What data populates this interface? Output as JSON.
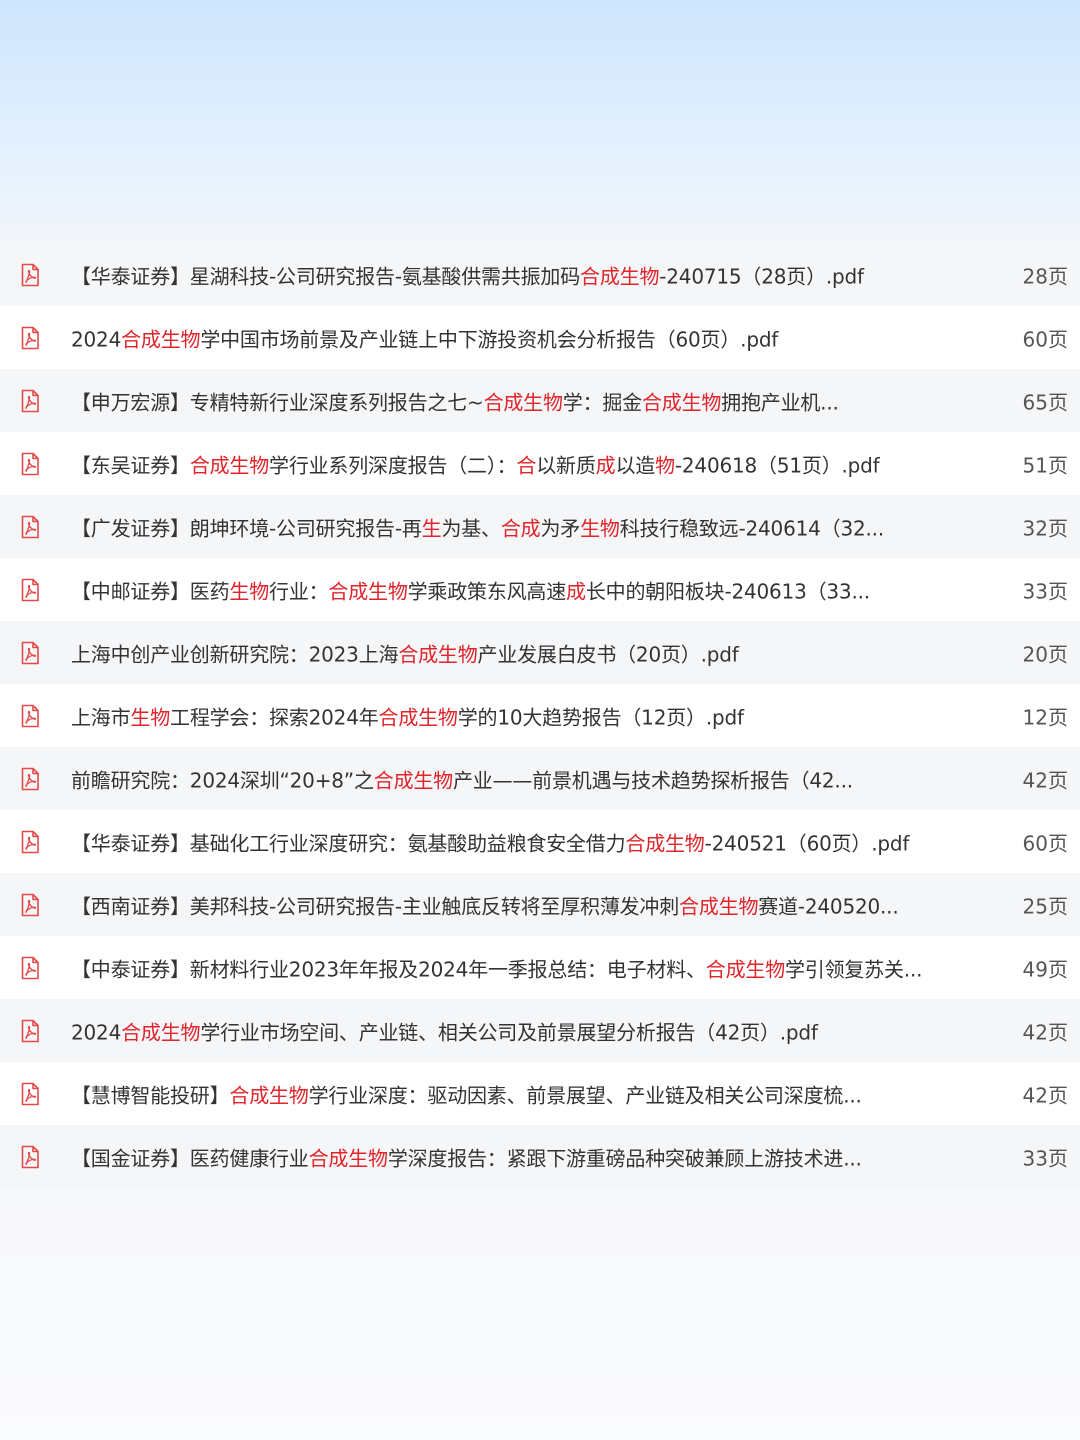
{
  "colors": {
    "highlight": "#e0242a",
    "text": "#333333",
    "icon": "#e44a4a"
  },
  "icon_name": "pdf-file-icon",
  "files": [
    {
      "segments": [
        {
          "t": "【华泰证券】星湖科技-公司研究报告-氨基酸供需共振加码"
        },
        {
          "t": "合成生物",
          "hl": true
        },
        {
          "t": "-240715（28页）.pdf"
        }
      ],
      "pages": "28页"
    },
    {
      "segments": [
        {
          "t": "2024"
        },
        {
          "t": "合成生物",
          "hl": true
        },
        {
          "t": "学中国市场前景及产业链上中下游投资机会分析报告（60页）.pdf"
        }
      ],
      "pages": "60页"
    },
    {
      "segments": [
        {
          "t": "【申万宏源】专精特新行业深度系列报告之七~"
        },
        {
          "t": "合成生物",
          "hl": true
        },
        {
          "t": "学：掘金"
        },
        {
          "t": "合成生物",
          "hl": true
        },
        {
          "t": "拥抱产业机..."
        }
      ],
      "pages": "65页"
    },
    {
      "segments": [
        {
          "t": "【东吴证券】"
        },
        {
          "t": "合成生物",
          "hl": true
        },
        {
          "t": "学行业系列深度报告（二）："
        },
        {
          "t": "合",
          "hl": true
        },
        {
          "t": "以新质"
        },
        {
          "t": "成",
          "hl": true
        },
        {
          "t": "以造"
        },
        {
          "t": "物",
          "hl": true
        },
        {
          "t": "-240618（51页）.pdf"
        }
      ],
      "pages": "51页"
    },
    {
      "segments": [
        {
          "t": "【广发证券】朗坤环境-公司研究报告-再"
        },
        {
          "t": "生",
          "hl": true
        },
        {
          "t": "为基、"
        },
        {
          "t": "合成",
          "hl": true
        },
        {
          "t": "为矛"
        },
        {
          "t": "生物",
          "hl": true
        },
        {
          "t": "科技行稳致远-240614（32..."
        }
      ],
      "pages": "32页"
    },
    {
      "segments": [
        {
          "t": "【中邮证券】医药"
        },
        {
          "t": "生物",
          "hl": true
        },
        {
          "t": "行业："
        },
        {
          "t": "合成生物",
          "hl": true
        },
        {
          "t": "学乘政策东风高速"
        },
        {
          "t": "成",
          "hl": true
        },
        {
          "t": "长中的朝阳板块-240613（33..."
        }
      ],
      "pages": "33页"
    },
    {
      "segments": [
        {
          "t": "上海中创产业创新研究院：2023上海"
        },
        {
          "t": "合成生物",
          "hl": true
        },
        {
          "t": "产业发展白皮书（20页）.pdf"
        }
      ],
      "pages": "20页"
    },
    {
      "segments": [
        {
          "t": "上海市"
        },
        {
          "t": "生物",
          "hl": true
        },
        {
          "t": "工程学会：探索2024年"
        },
        {
          "t": "合成生物",
          "hl": true
        },
        {
          "t": "学的10大趋势报告（12页）.pdf"
        }
      ],
      "pages": "12页"
    },
    {
      "segments": [
        {
          "t": "前瞻研究院：2024深圳“20+8”之"
        },
        {
          "t": "合成生物",
          "hl": true
        },
        {
          "t": "产业——前景机遇与技术趋势探析报告（42..."
        }
      ],
      "pages": "42页"
    },
    {
      "segments": [
        {
          "t": "【华泰证券】基础化工行业深度研究：氨基酸助益粮食安全借力"
        },
        {
          "t": "合成生物",
          "hl": true
        },
        {
          "t": "-240521（60页）.pdf"
        }
      ],
      "pages": "60页"
    },
    {
      "segments": [
        {
          "t": "【西南证券】美邦科技-公司研究报告-主业触底反转将至厚积薄发冲刺"
        },
        {
          "t": "合成生物",
          "hl": true
        },
        {
          "t": "赛道-240520..."
        }
      ],
      "pages": "25页"
    },
    {
      "segments": [
        {
          "t": "【中泰证券】新材料行业2023年年报及2024年一季报总结：电子材料、"
        },
        {
          "t": "合成生物",
          "hl": true
        },
        {
          "t": "学引领复苏关..."
        }
      ],
      "pages": "49页"
    },
    {
      "segments": [
        {
          "t": "2024"
        },
        {
          "t": "合成生物",
          "hl": true
        },
        {
          "t": "学行业市场空间、产业链、相关公司及前景展望分析报告（42页）.pdf"
        }
      ],
      "pages": "42页"
    },
    {
      "segments": [
        {
          "t": "【慧博智能投研】"
        },
        {
          "t": "合成生物",
          "hl": true
        },
        {
          "t": "学行业深度：驱动因素、前景展望、产业链及相关公司深度梳..."
        }
      ],
      "pages": "42页"
    },
    {
      "segments": [
        {
          "t": "【国金证券】医药健康行业"
        },
        {
          "t": "合成生物",
          "hl": true
        },
        {
          "t": "学深度报告：紧跟下游重磅品种突破兼顾上游技术进..."
        }
      ],
      "pages": "33页"
    }
  ]
}
